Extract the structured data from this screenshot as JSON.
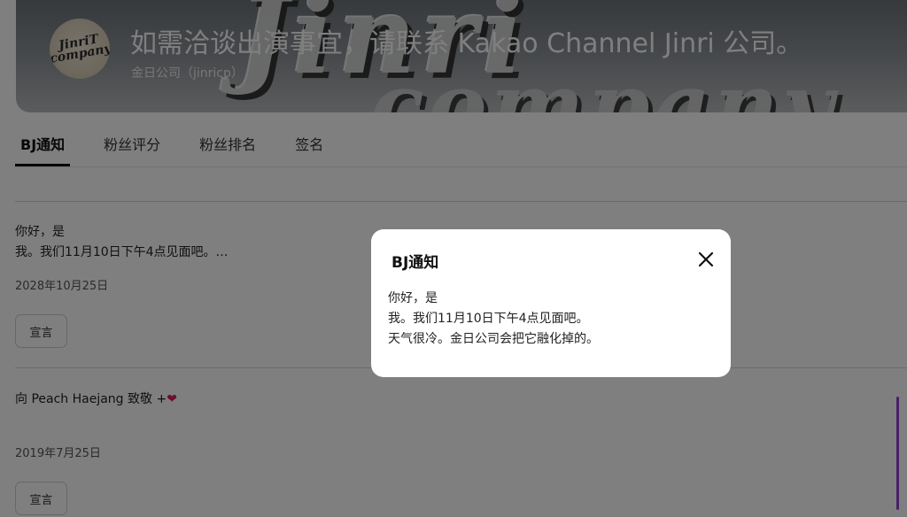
{
  "header": {
    "avatar_text": "JinriT company",
    "title": "如需洽谈出演事宜，请联系 Kakao Channel Jinri 公司。",
    "subtitle": "金日公司（jinricp）"
  },
  "tabs": [
    {
      "label": "BJ通知",
      "active": true
    },
    {
      "label": "粉丝评分",
      "active": false
    },
    {
      "label": "粉丝排名",
      "active": false
    },
    {
      "label": "签名",
      "active": false
    }
  ],
  "posts": [
    {
      "line1": "你好，是",
      "line2": "我。我们11月10日下午4点见面吧。…",
      "date": "2028年10月25日",
      "button": "宣言"
    },
    {
      "line1": "向 Peach Haejang 致敬 +",
      "date": "2019年7月25日",
      "button": "宣言"
    }
  ],
  "modal": {
    "title": "BJ通知",
    "lines": [
      "你好，是",
      "我。我们11月10日下午4点见面吧。",
      "天气很冷。金日公司会把它融化掉的。"
    ],
    "close_icon": "close-icon"
  },
  "colors": {
    "accent_scrollbar": "#8c3fd0",
    "heart": "#e0185c",
    "overlay": "rgba(0,0,0,0.5)"
  }
}
